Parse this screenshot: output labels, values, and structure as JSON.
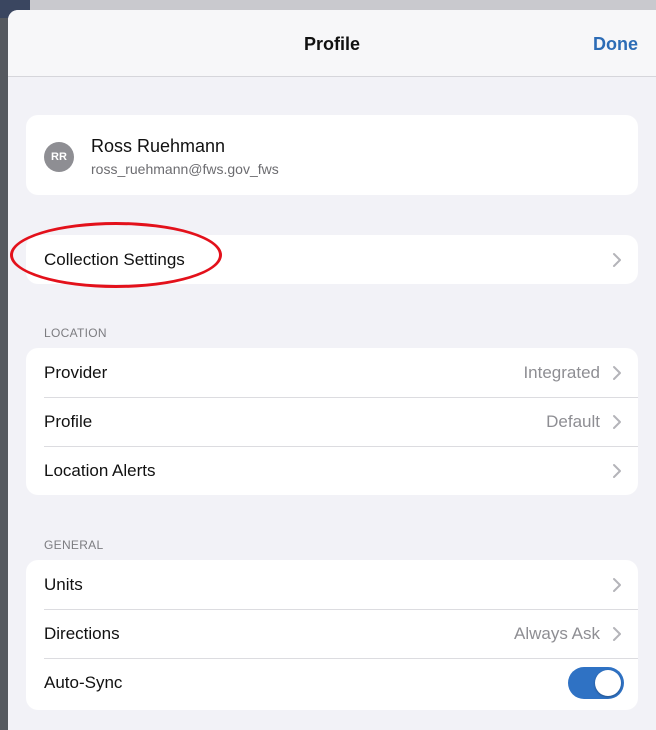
{
  "navbar": {
    "title": "Profile",
    "done_label": "Done"
  },
  "profile": {
    "initials": "RR",
    "name": "Ross Ruehmann",
    "email": "ross_ruehmann@fws.gov_fws"
  },
  "collection": {
    "label": "Collection Settings"
  },
  "location": {
    "header": "LOCATION",
    "rows": [
      {
        "label": "Provider",
        "value": "Integrated"
      },
      {
        "label": "Profile",
        "value": "Default"
      },
      {
        "label": "Location Alerts",
        "value": ""
      }
    ]
  },
  "general": {
    "header": "GENERAL",
    "rows": [
      {
        "label": "Units",
        "value": ""
      },
      {
        "label": "Directions",
        "value": "Always Ask"
      },
      {
        "label": "Auto-Sync",
        "toggle_on": true
      }
    ]
  },
  "colors": {
    "accent": "#2c6cb6",
    "toggle": "#2f72c4",
    "annotation": "#e3111b"
  },
  "icons": {
    "chevron": "chevron-right-icon"
  }
}
